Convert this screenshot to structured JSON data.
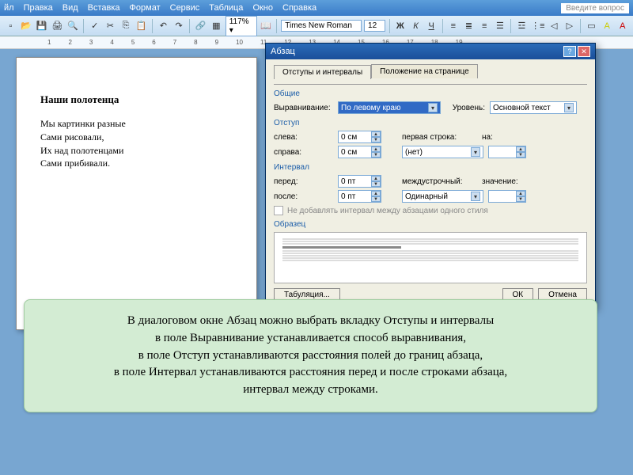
{
  "menubar": {
    "items": [
      "йл",
      "Правка",
      "Вид",
      "Вставка",
      "Формат",
      "Сервис",
      "Таблица",
      "Окно",
      "Справка"
    ],
    "help_placeholder": "Введите вопрос"
  },
  "toolbar": {
    "zoom": "117%",
    "font_family": "Times New Roman",
    "font_size": "12",
    "bold": "Ж",
    "italic": "К",
    "underline": "Ч"
  },
  "ruler": [
    "1",
    "2",
    "3",
    "4",
    "5",
    "6",
    "7",
    "8",
    "9",
    "10",
    "11",
    "12",
    "13",
    "14",
    "15",
    "16",
    "17",
    "18",
    "19"
  ],
  "document": {
    "title": "Наши полотенца",
    "lines": [
      "Мы картинки разные",
      "Сами рисовали,",
      "Их над полотенцами",
      "Сами прибивали."
    ]
  },
  "dialog": {
    "title": "Абзац",
    "tabs": {
      "indents": "Отступы и интервалы",
      "position": "Положение на странице"
    },
    "general": {
      "title": "Общие",
      "alignment_label": "Выравнивание:",
      "alignment_value": "По левому краю",
      "level_label": "Уровень:",
      "level_value": "Основной текст"
    },
    "indent": {
      "title": "Отступ",
      "left_label": "слева:",
      "left_value": "0 см",
      "right_label": "справа:",
      "right_value": "0 см",
      "first_label": "первая строка:",
      "first_value": "(нет)",
      "on_label": "на:",
      "on_value": ""
    },
    "interval": {
      "title": "Интервал",
      "before_label": "перед:",
      "before_value": "0 пт",
      "after_label": "после:",
      "after_value": "0 пт",
      "line_label": "междустрочный:",
      "line_value": "Одинарный",
      "val_label": "значение:",
      "val_value": ""
    },
    "checkbox": "Не добавлять интервал между абзацами одного стиля",
    "preview_title": "Образец",
    "tabulation": "Табуляция...",
    "ok": "ОК",
    "cancel": "Отмена"
  },
  "callout": {
    "l1": "В диалоговом окне Абзац можно выбрать вкладку Отступы и интервалы",
    "l2": "в поле Выравнивание устанавливается способ выравнивания,",
    "l3": "в поле Отступ устанавливаются расстояния полей до границ абзаца,",
    "l4": "в поле Интервал устанавливаются расстояния перед и после строками абзаца,",
    "l5": "интервал между строками."
  }
}
